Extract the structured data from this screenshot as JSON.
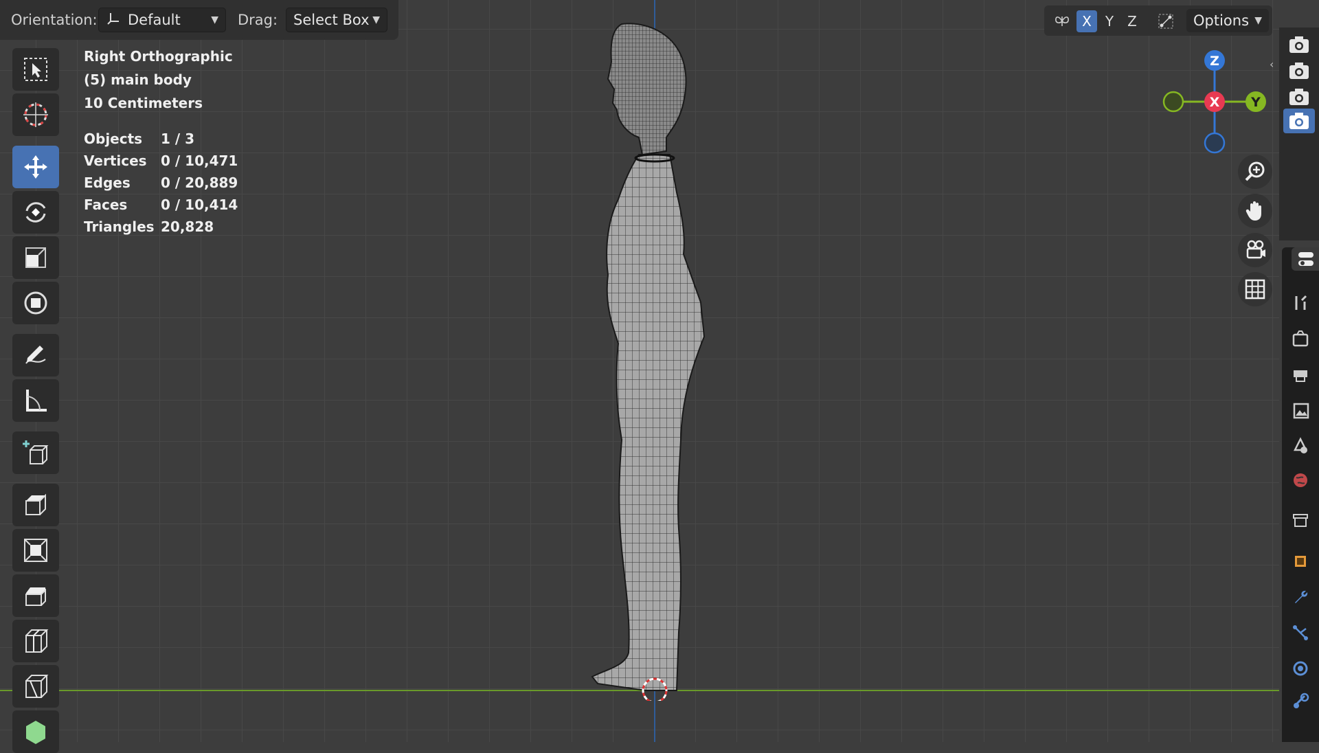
{
  "header": {
    "orientation_label": "Orientation:",
    "orientation_value": "Default",
    "drag_label": "Drag:",
    "drag_value": "Select Box",
    "axis_x": "X",
    "axis_y": "Y",
    "axis_z": "Z",
    "options_label": "Options"
  },
  "viewport_info": {
    "view_name": "Right Orthographic",
    "object_name": "(5) main body",
    "grid_scale": "10 Centimeters"
  },
  "stats": {
    "objects_label": "Objects",
    "objects_value": "1 / 3",
    "vertices_label": "Vertices",
    "vertices_value": "0 / 10,471",
    "edges_label": "Edges",
    "edges_value": "0 / 20,889",
    "faces_label": "Faces",
    "faces_value": "0 / 10,414",
    "triangles_label": "Triangles",
    "triangles_value": "20,828"
  },
  "gizmo": {
    "z": "Z",
    "x": "X",
    "y": "Y"
  },
  "toolbar": {
    "tools": [
      "select-box",
      "cursor",
      "move",
      "rotate",
      "scale",
      "transform",
      "annotate",
      "measure",
      "add-cube",
      "extrude-region",
      "inset-faces",
      "bevel",
      "loop-cut",
      "knife",
      "poly-build"
    ],
    "active_tool": "move"
  },
  "colors": {
    "active_blue": "#4772b3",
    "axis_x_red": "#e83a52",
    "axis_y_green": "#86b822",
    "axis_z_blue": "#3477d6",
    "viewport_bg": "#3d3d3d"
  }
}
